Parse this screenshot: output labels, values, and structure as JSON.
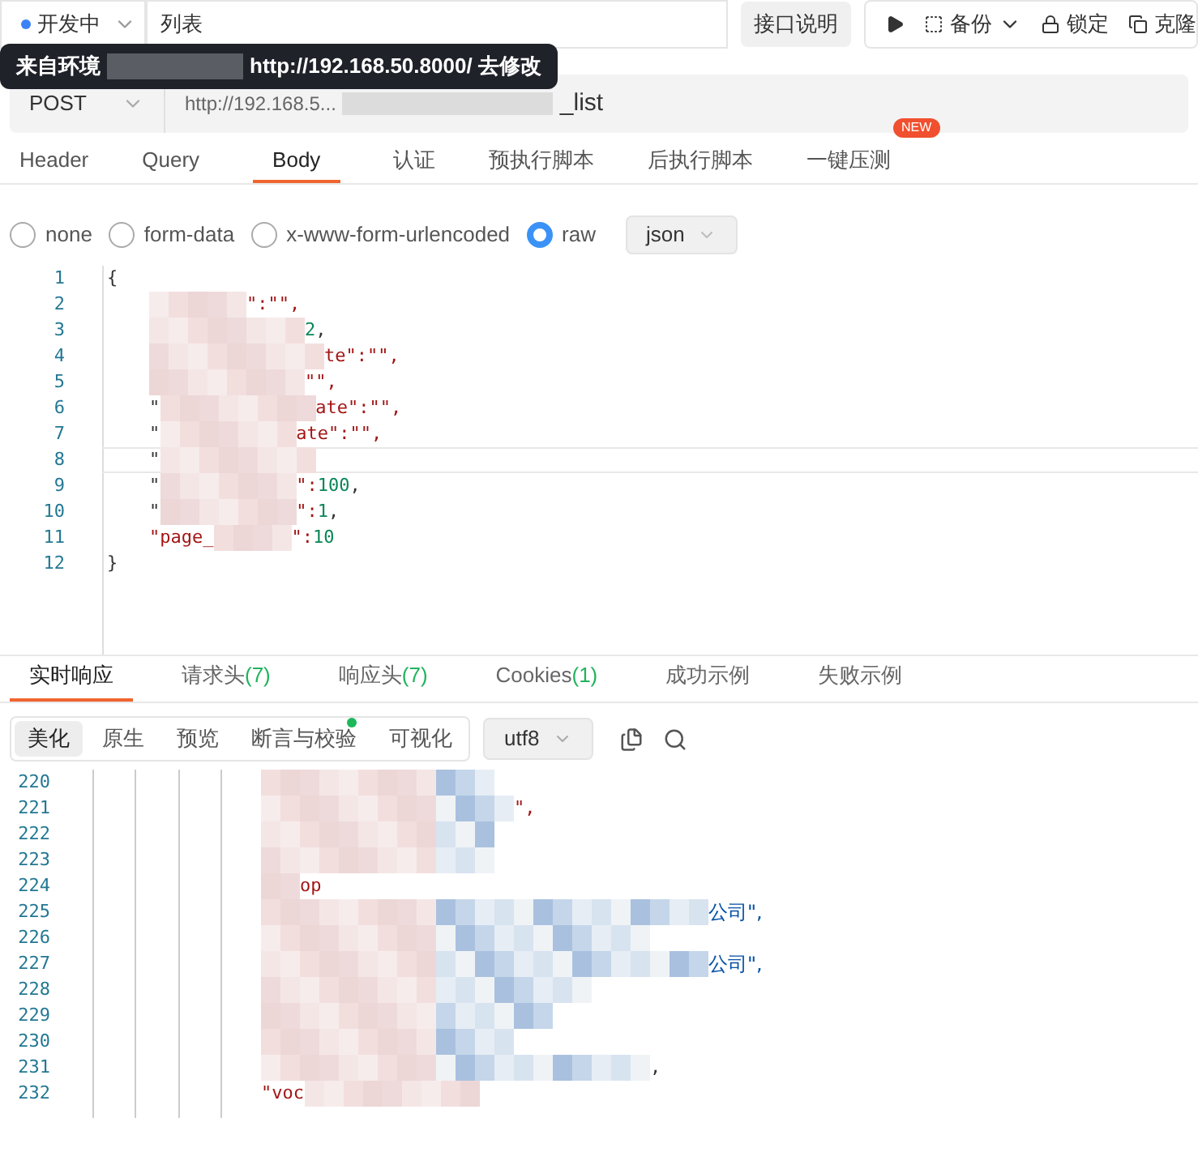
{
  "top_bar": {
    "status": {
      "label": "开发中",
      "color": "#3b82f6"
    },
    "name": "列表",
    "doc_button": "接口说明",
    "backup": "备份",
    "lock": "锁定",
    "clone": "克隆"
  },
  "tooltip": {
    "prefix": "来自环境",
    "url": "http://192.168.50.8000/",
    "action": "去修改"
  },
  "request": {
    "method": "POST",
    "url_start": "http://192.168.5...",
    "url_end": "_list"
  },
  "tabs": [
    {
      "label": "Header",
      "selected": false
    },
    {
      "label": "Query",
      "selected": false
    },
    {
      "label": "Body",
      "selected": true
    },
    {
      "label": "认证",
      "selected": false
    },
    {
      "label": "预执行脚本",
      "selected": false
    },
    {
      "label": "后执行脚本",
      "selected": false
    },
    {
      "label": "一键压测",
      "selected": false,
      "badge": "NEW"
    }
  ],
  "body_types": [
    {
      "label": "none",
      "selected": false
    },
    {
      "label": "form-data",
      "selected": false
    },
    {
      "label": "x-www-form-urlencoded",
      "selected": false
    },
    {
      "label": "raw",
      "selected": true
    }
  ],
  "format": "json",
  "request_lines": [
    {
      "n": "1",
      "lead": "{"
    },
    {
      "n": "2",
      "tail": "\":\"\",",
      "redacted": true
    },
    {
      "n": "3",
      "tail": "2,",
      "redacted": true
    },
    {
      "n": "4",
      "tail": "te\":\"\",",
      "redacted": true
    },
    {
      "n": "5",
      "tail": "\"\",",
      "redacted": true
    },
    {
      "n": "6",
      "lead": "\"",
      "tail": "ate\":\"\",",
      "redacted": true
    },
    {
      "n": "7",
      "lead": "\"",
      "tail": "ate\":\"\",",
      "redacted": true
    },
    {
      "n": "8",
      "lead": "\"",
      "redacted": true
    },
    {
      "n": "9",
      "lead": "\"",
      "tail": "\":100,",
      "redacted": true
    },
    {
      "n": "10",
      "lead": "\"",
      "tail": "\":1,",
      "redacted": true
    },
    {
      "n": "11",
      "lead": "\"page_",
      "tail": "\":10",
      "redacted": true
    },
    {
      "n": "12",
      "lead": "}"
    }
  ],
  "response_tabs": [
    {
      "label": "实时响应",
      "selected": true
    },
    {
      "label": "请求头",
      "count": "(7)",
      "selected": false
    },
    {
      "label": "响应头",
      "count": "(7)",
      "selected": false
    },
    {
      "label": "Cookies",
      "count": "(1)",
      "selected": false
    },
    {
      "label": "成功示例",
      "selected": false
    },
    {
      "label": "失败示例",
      "selected": false
    }
  ],
  "view_modes": [
    {
      "label": "美化",
      "selected": true,
      "dot": false
    },
    {
      "label": "原生",
      "selected": false,
      "dot": false
    },
    {
      "label": "预览",
      "selected": false,
      "dot": false
    },
    {
      "label": "断言与校验",
      "selected": false,
      "dot": true
    },
    {
      "label": "可视化",
      "selected": false,
      "dot": false
    }
  ],
  "encoding": "utf8",
  "response_lines": [
    {
      "n": "220",
      "redacted": true
    },
    {
      "n": "221",
      "tail": "\",",
      "redacted": true
    },
    {
      "n": "222",
      "redacted": true
    },
    {
      "n": "223",
      "redacted": true
    },
    {
      "n": "224",
      "tail": "op",
      "redacted": true
    },
    {
      "n": "225",
      "tail": "公司\",",
      "redacted": true
    },
    {
      "n": "226",
      "redacted": true
    },
    {
      "n": "227",
      "tail": "公司\",",
      "redacted": true
    },
    {
      "n": "228",
      "redacted": true
    },
    {
      "n": "229",
      "redacted": true
    },
    {
      "n": "230",
      "redacted": true
    },
    {
      "n": "231",
      "tail": ",",
      "redacted": true
    },
    {
      "n": "232",
      "lead": "\"voc",
      "redacted": true
    }
  ]
}
